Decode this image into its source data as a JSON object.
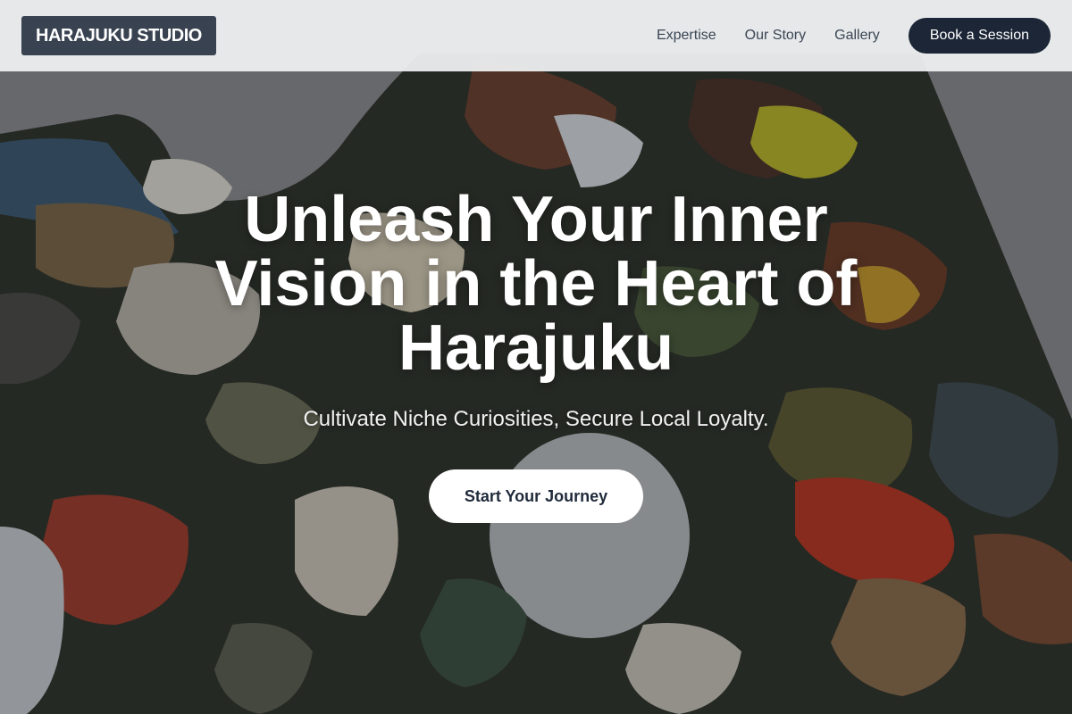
{
  "nav": {
    "logo": "HARAJUKU STUDIO",
    "links": [
      "Expertise",
      "Our Story",
      "Gallery"
    ],
    "cta": "Book a Session"
  },
  "hero": {
    "title": "Unleash Your Inner Vision in the Heart of Harajuku",
    "subtitle": "Cultivate Niche Curiosities, Secure Local Loyalty.",
    "cta": "Start Your Journey"
  },
  "colors": {
    "navbar_bg": "#eef0f2",
    "logo_bg": "#384250",
    "nav_cta_bg": "#1c2636",
    "hero_cta_bg": "#ffffff"
  }
}
